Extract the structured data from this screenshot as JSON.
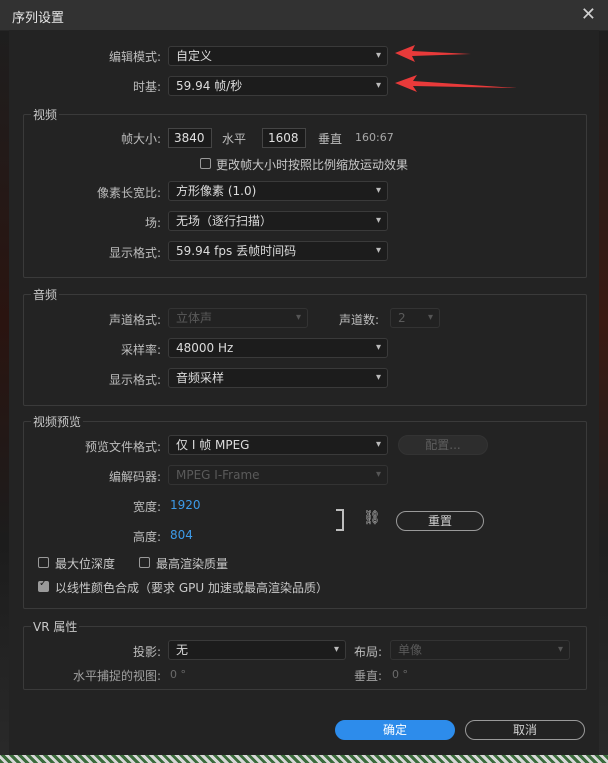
{
  "window": {
    "title": "序列设置",
    "close_icon": "close-icon"
  },
  "top": {
    "edit_mode_label": "编辑模式:",
    "edit_mode_value": "自定义",
    "timebase_label": "时基:",
    "timebase_value": "59.94  帧/秒"
  },
  "video": {
    "section": "视频",
    "frame_size_label": "帧大小:",
    "width": "3840",
    "horizontal_label": "水平",
    "height": "1608",
    "vertical_label": "垂直",
    "ratio": "160:67",
    "scale_motion_label": "更改帧大小时按照比例缩放运动效果",
    "pixel_aspect_label": "像素长宽比:",
    "pixel_aspect_value": "方形像素 (1.0)",
    "fields_label": "场:",
    "fields_value": "无场（逐行扫描）",
    "display_format_label": "显示格式:",
    "display_format_value": "59.94 fps 丢帧时间码"
  },
  "audio": {
    "section": "音频",
    "channel_format_label": "声道格式:",
    "channel_format_value": "立体声",
    "channels_label": "声道数:",
    "channels_value": "2",
    "sample_rate_label": "采样率:",
    "sample_rate_value": "48000 Hz",
    "display_format_label": "显示格式:",
    "display_format_value": "音频采样"
  },
  "preview": {
    "section": "视频预览",
    "file_format_label": "预览文件格式:",
    "file_format_value": "仅 I 帧 MPEG",
    "configure_label": "配置...",
    "codec_label": "编解码器:",
    "codec_value": "MPEG I-Frame",
    "width_label": "宽度:",
    "width_value": "1920",
    "height_label": "高度:",
    "height_value": "804",
    "reset_label": "重置",
    "max_bit_depth_label": "最大位深度",
    "max_render_quality_label": "最高渲染质量",
    "linear_color_label": "以线性颜色合成（要求 GPU 加速或最高渲染品质）"
  },
  "vr": {
    "section": "VR 属性",
    "projection_label": "投影:",
    "projection_value": "无",
    "layout_label": "布局:",
    "layout_value": "单像",
    "h_view_label": "水平捕捉的视图:",
    "h_view_value": "0 °",
    "v_label": "垂直:",
    "v_value": "0 °"
  },
  "footer": {
    "ok_label": "确定",
    "cancel_label": "取消"
  },
  "colors": {
    "accent": "#2d8ceb",
    "annotation_arrow": "#e83a3a"
  }
}
